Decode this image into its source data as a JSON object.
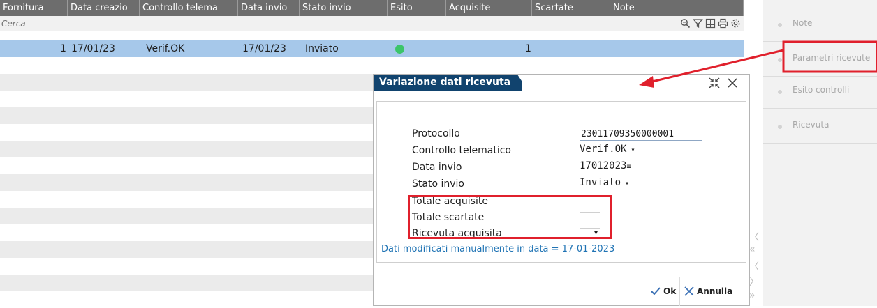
{
  "table": {
    "columns": [
      {
        "label": "Fornitura",
        "width": 97
      },
      {
        "label": "Data creazio",
        "width": 103
      },
      {
        "label": "Controllo telema",
        "width": 141
      },
      {
        "label": "Data invio",
        "width": 88
      },
      {
        "label": "Stato invio",
        "width": 126
      },
      {
        "label": "Esito",
        "width": 84
      },
      {
        "label": "Acquisite",
        "width": 123
      },
      {
        "label": "Scartate",
        "width": 112
      },
      {
        "label": "Note",
        "width": 191
      }
    ],
    "search_placeholder": "Cerca",
    "rows": [
      {
        "fornitura": "1",
        "data_creazione": "17/01/23",
        "controllo": "Verif.OK",
        "data_invio": "17/01/23",
        "stato": "Inviato",
        "esito": "green-dot",
        "acquisite": "1"
      }
    ],
    "toolbar_icons": [
      "zoom-icon",
      "filter-icon",
      "excel-icon",
      "print-icon",
      "settings-icon"
    ]
  },
  "right_panel": {
    "items": [
      "Note",
      "Parametri ricevute",
      "Esito controlli",
      "Ricevuta"
    ]
  },
  "dialog": {
    "title": "Variazione dati ricevuta",
    "fields": {
      "protocollo": {
        "label": "Protocollo",
        "value": "23011709350000001"
      },
      "controllo": {
        "label": "Controllo telematico",
        "value": "Verif.OK"
      },
      "data_invio": {
        "label": "Data invio",
        "value": "17012023"
      },
      "stato_invio": {
        "label": "Stato invio",
        "value": "Inviato"
      },
      "totale_acquisite": {
        "label": "Totale acquisite",
        "value": ""
      },
      "totale_scartate": {
        "label": "Totale scartate",
        "value": ""
      },
      "ricevuta_acquisita": {
        "label": "Ricevuta acquisita",
        "value": ""
      }
    },
    "manual_note": "Dati modificati manualmente in data = 17-01-2023",
    "ok_label": "Ok",
    "cancel_label": "Annulla"
  },
  "colors": {
    "header_bg": "#6d6d6d",
    "selected_row": "#a6c8ea",
    "dialog_title_bg": "#11436e",
    "highlight_red": "#e0202c",
    "status_green": "#3cc56a",
    "link_blue": "#1f73b4"
  }
}
